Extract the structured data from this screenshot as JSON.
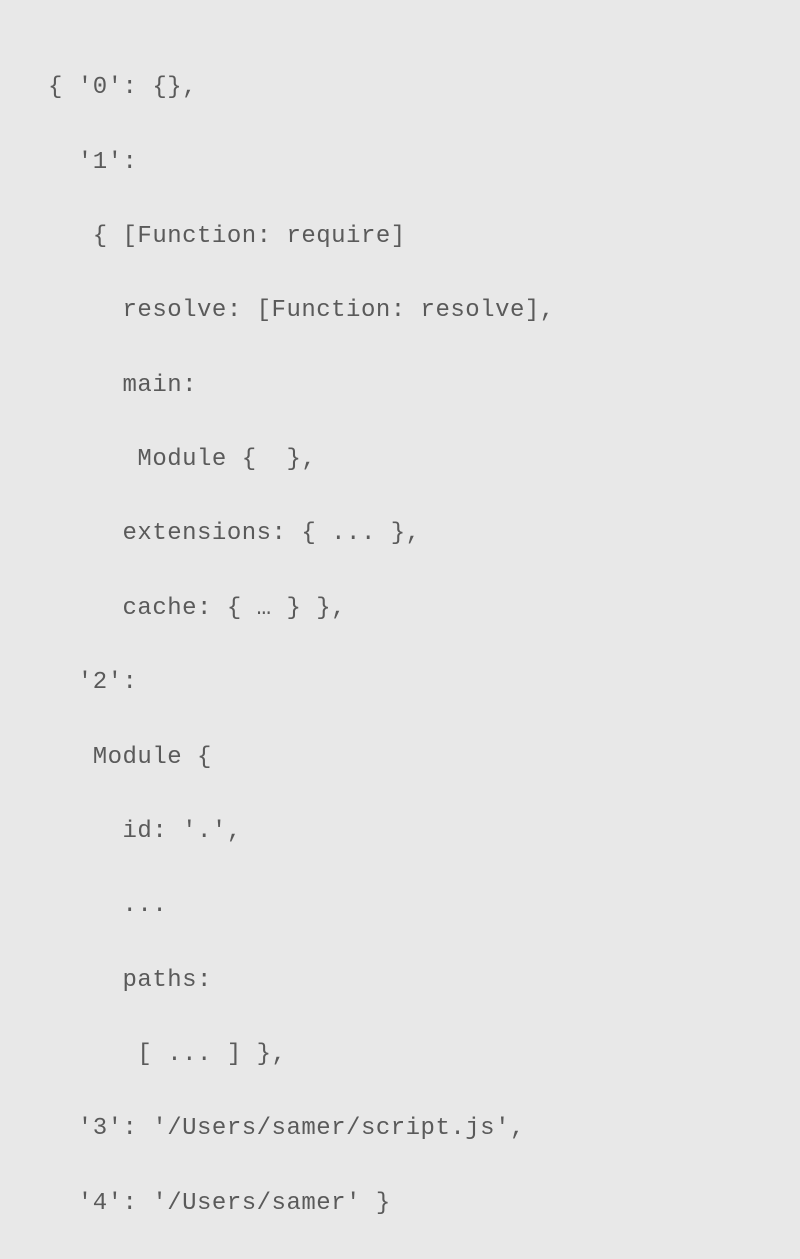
{
  "code": {
    "lines": [
      "{ '0': {},",
      "  '1':",
      "   { [Function: require]",
      "     resolve: [Function: resolve],",
      "     main:",
      "      Module {  },",
      "     extensions: { ... },",
      "     cache: { … } },",
      "  '2':",
      "   Module {",
      "     id: '.',",
      "     ...",
      "     paths:",
      "      [ ... ] },",
      "  '3': '/Users/samer/script.js',",
      "  '4': '/Users/samer' }"
    ]
  }
}
